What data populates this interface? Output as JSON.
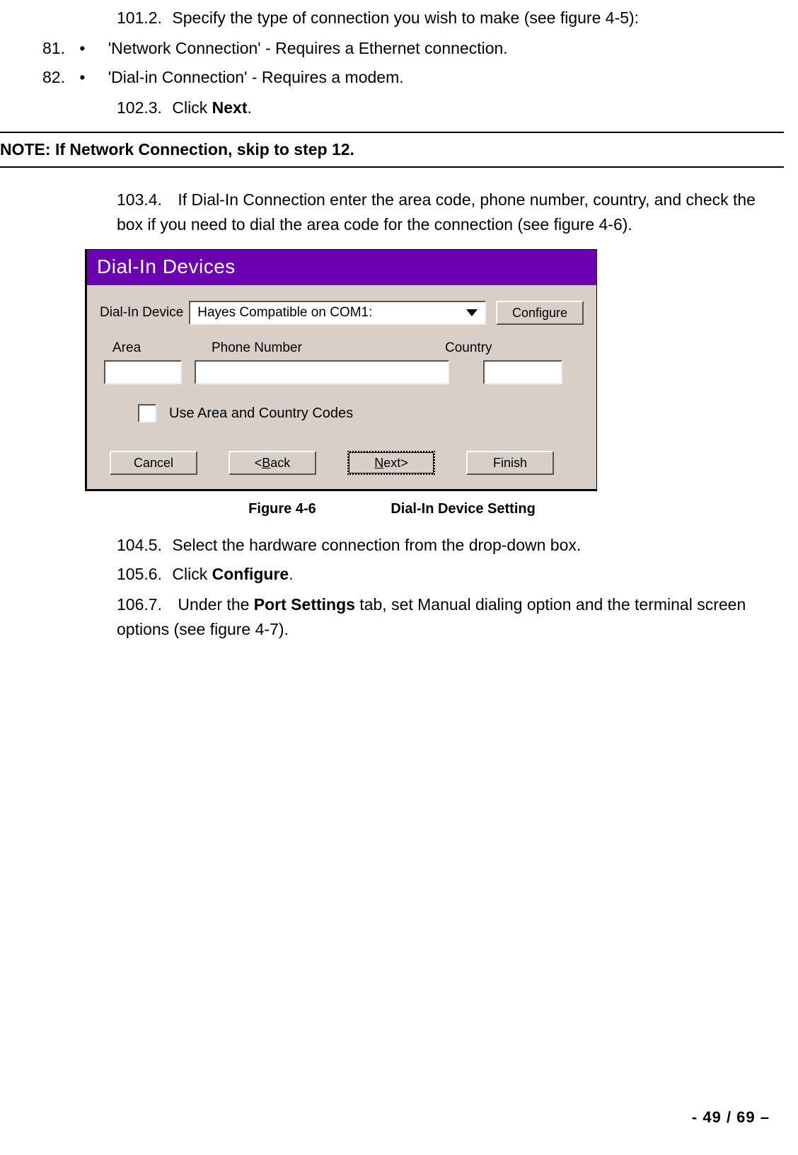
{
  "steps": {
    "s101_num": "101.2.",
    "s101_txt": "Specify the type of connection you wish to make (see figure 4-5):",
    "s81_n": "81.",
    "s81_txt": "'Network Connection' - Requires a Ethernet connection.",
    "s82_n": "82.",
    "s82_txt": "'Dial-in Connection' - Requires a modem.",
    "s102_num": "102.3.",
    "s102_pre": "Click ",
    "s102_bold": "Next",
    "s102_post": ".",
    "s103_num": "103.4.",
    "s103_txt": "If Dial-In Connection enter the area code, phone number, country, and check the box if you need to dial the area code for the connection (see figure 4-6).",
    "s104_num": "104.5.",
    "s104_txt": "Select the hardware connection from the drop-down box.",
    "s105_num": "105.6.",
    "s105_pre": "Click ",
    "s105_bold": "Configure",
    "s105_post": ".",
    "s106_num": "106.7.",
    "s106_pre": "Under the ",
    "s106_bold": "Port Settings",
    "s106_post": " tab, set Manual dialing option and the terminal screen options (see figure 4-7)."
  },
  "note": "NOTE: If Network Connection, skip to step 12.",
  "dialog": {
    "title": "Dial-In Devices",
    "device_label": "Dial-In Device",
    "device_value": "Hayes Compatible on COM1:",
    "configure": "Configure",
    "area": "Area",
    "phone": "Phone Number",
    "country": "Country",
    "use_codes": "Use Area and Country Codes",
    "cancel": "Cancel",
    "back_u": "B",
    "back_rest": "ack",
    "back_prefix": "<",
    "next_u": "N",
    "next_rest": "ext>",
    "finish": "Finish"
  },
  "figure": {
    "left": "Figure 4-6",
    "right": "Dial-In Device Setting"
  },
  "footer": "-  49 / 69 –"
}
